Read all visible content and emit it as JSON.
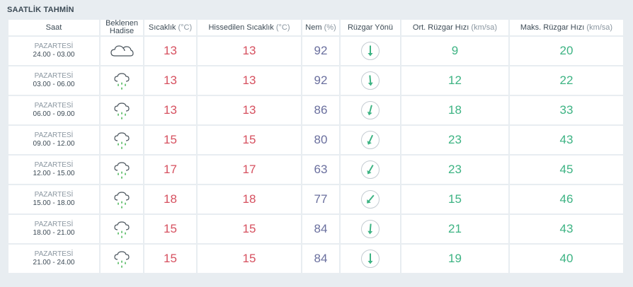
{
  "section_title": "SAATLİK TAHMİN",
  "columns": [
    {
      "label": "Saat",
      "unit": ""
    },
    {
      "label": "Beklenen Hadise",
      "unit": ""
    },
    {
      "label": "Sıcaklık",
      "unit": "(°C)"
    },
    {
      "label": "Hissedilen Sıcaklık",
      "unit": "(°C)"
    },
    {
      "label": "Nem",
      "unit": "(%)"
    },
    {
      "label": "Rüzgar Yönü",
      "unit": ""
    },
    {
      "label": "Ort. Rüzgar Hızı",
      "unit": "(km/sa)"
    },
    {
      "label": "Maks. Rüzgar Hızı",
      "unit": "(km/sa)"
    }
  ],
  "rows": [
    {
      "day": "PAZARTESİ",
      "hours": "24.00 - 03.00",
      "icon": "cloudy-icon",
      "temp": "13",
      "feels": "13",
      "humidity": "92",
      "wind_dir_deg": 180,
      "wind_avg": "9",
      "wind_max": "20"
    },
    {
      "day": "PAZARTESİ",
      "hours": "03.00 - 06.00",
      "icon": "rain-cloud-icon",
      "temp": "13",
      "feels": "13",
      "humidity": "92",
      "wind_dir_deg": 175,
      "wind_avg": "12",
      "wind_max": "22"
    },
    {
      "day": "PAZARTESİ",
      "hours": "06.00 - 09.00",
      "icon": "rain-cloud-icon",
      "temp": "13",
      "feels": "13",
      "humidity": "86",
      "wind_dir_deg": 195,
      "wind_avg": "18",
      "wind_max": "33"
    },
    {
      "day": "PAZARTESİ",
      "hours": "09.00 - 12.00",
      "icon": "rain-cloud-icon",
      "temp": "15",
      "feels": "15",
      "humidity": "80",
      "wind_dir_deg": 205,
      "wind_avg": "23",
      "wind_max": "43"
    },
    {
      "day": "PAZARTESİ",
      "hours": "12.00 - 15.00",
      "icon": "rain-cloud-icon",
      "temp": "17",
      "feels": "17",
      "humidity": "63",
      "wind_dir_deg": 210,
      "wind_avg": "23",
      "wind_max": "45"
    },
    {
      "day": "PAZARTESİ",
      "hours": "15.00 - 18.00",
      "icon": "rain-cloud-icon",
      "temp": "18",
      "feels": "18",
      "humidity": "77",
      "wind_dir_deg": 220,
      "wind_avg": "15",
      "wind_max": "46"
    },
    {
      "day": "PAZARTESİ",
      "hours": "18.00 - 21.00",
      "icon": "rain-cloud-icon",
      "temp": "15",
      "feels": "15",
      "humidity": "84",
      "wind_dir_deg": 185,
      "wind_avg": "21",
      "wind_max": "43"
    },
    {
      "day": "PAZARTESİ",
      "hours": "21.00 - 24.00",
      "icon": "rain-cloud-icon",
      "temp": "15",
      "feels": "15",
      "humidity": "84",
      "wind_dir_deg": 180,
      "wind_avg": "19",
      "wind_max": "40"
    }
  ],
  "colors": {
    "temperature": "#d6505f",
    "humidity": "#6a6f9e",
    "wind": "#3db383",
    "rain": "#5fbf6c",
    "cloud_outline": "#4a545c"
  }
}
